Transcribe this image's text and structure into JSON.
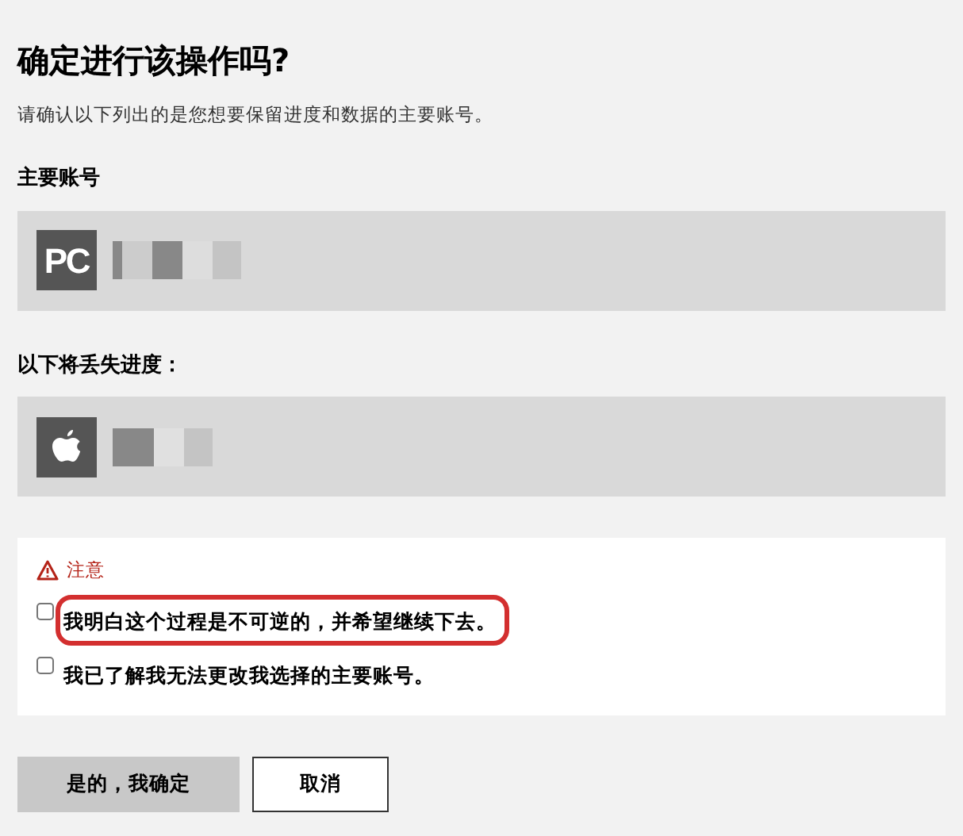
{
  "title": "确定进行该操作吗?",
  "description": "请确认以下列出的是您想要保留进度和数据的主要账号。",
  "primary_account": {
    "label": "主要账号",
    "platform": {
      "kind": "pc",
      "text": "PC"
    }
  },
  "lost_account": {
    "label": "以下将丢失进度：",
    "platform": {
      "kind": "apple"
    }
  },
  "notice": {
    "title": "注意",
    "items": [
      {
        "text": "我明白这个过程是不可逆的，并希望继续下去。",
        "checked": false,
        "highlighted": true
      },
      {
        "text": "我已了解我无法更改我选择的主要账号。",
        "checked": false,
        "highlighted": false
      }
    ]
  },
  "buttons": [
    {
      "label": "是的，我确定",
      "kind": "primary"
    },
    {
      "label": "取消",
      "kind": "secondary"
    }
  ]
}
